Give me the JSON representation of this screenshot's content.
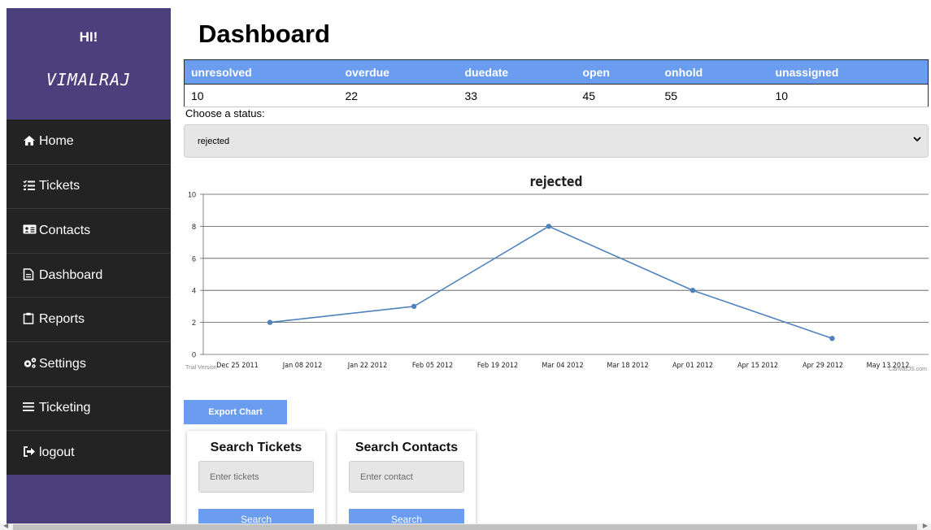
{
  "sidebar": {
    "greeting": "HI!",
    "username": "VIMALRAJ",
    "items": [
      {
        "label": "Home",
        "icon": "home-icon"
      },
      {
        "label": "Tickets",
        "icon": "list-check-icon"
      },
      {
        "label": "Contacts",
        "icon": "id-card-icon"
      },
      {
        "label": "Dashboard",
        "icon": "file-icon"
      },
      {
        "label": "Reports",
        "icon": "clipboard-icon"
      },
      {
        "label": "Settings",
        "icon": "gears-icon"
      },
      {
        "label": "Ticketing",
        "icon": "bars-icon"
      },
      {
        "label": "logout",
        "icon": "sign-out-icon"
      }
    ]
  },
  "main": {
    "title": "Dashboard",
    "summary": {
      "headers": [
        "unresolved",
        "overdue",
        "duedate",
        "open",
        "onhold",
        "unassigned"
      ],
      "values": [
        "10",
        "22",
        "33",
        "45",
        "55",
        "10"
      ]
    },
    "status_label": "Choose a status:",
    "status_selected": "rejected",
    "export_label": "Export Chart",
    "search_tickets": {
      "title": "Search Tickets",
      "placeholder": "Enter tickets",
      "button": "Search"
    },
    "search_contacts": {
      "title": "Search Contacts",
      "placeholder": "Enter contact",
      "button": "Search"
    }
  },
  "chart_data": {
    "type": "line",
    "title": "rejected",
    "x_ticks": [
      "Dec 25 2011",
      "Jan 08 2012",
      "Jan 22 2012",
      "Feb 05 2012",
      "Feb 19 2012",
      "Mar 04 2012",
      "Mar 18 2012",
      "Apr 01 2012",
      "Apr 15 2012",
      "Apr 29 2012",
      "May 13 2012"
    ],
    "y_ticks": [
      0,
      2,
      4,
      6,
      8,
      10
    ],
    "ylim": [
      0,
      10
    ],
    "points": [
      {
        "x": "2012-01-01",
        "y": 2
      },
      {
        "x": "2012-02-01",
        "y": 3
      },
      {
        "x": "2012-03-01",
        "y": 8
      },
      {
        "x": "2012-04-01",
        "y": 4
      },
      {
        "x": "2012-05-01",
        "y": 1
      }
    ],
    "watermark_left": "Trial Version",
    "watermark_right": "CanvasJS.com",
    "line_color": "#4f81bc",
    "grid": true
  }
}
